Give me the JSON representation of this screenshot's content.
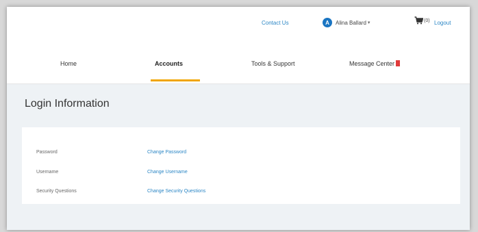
{
  "utility_bar": {
    "contact_us": "Contact Us",
    "user_initial": "A",
    "user_name": "Alina Ballard",
    "user_chevron": "▾",
    "cart_count": "(0)",
    "logout": "Logout"
  },
  "nav": {
    "tabs": [
      {
        "label": "Home"
      },
      {
        "label": "Accounts",
        "active": true
      },
      {
        "label": "Tools & Support"
      },
      {
        "label": "Message Center"
      }
    ],
    "active_accent": "#f0a500",
    "badge_color": "#e03a3a"
  },
  "main": {
    "title": "Login Information",
    "rows": [
      {
        "label": "Password",
        "link": "Change Password"
      },
      {
        "label": "Username",
        "link": "Change Username"
      },
      {
        "label": "Security Questions",
        "link": "Change Security Questions"
      }
    ]
  },
  "colors": {
    "link": "#2b86c5",
    "content_bg": "#eef2f5"
  },
  "icons": {
    "user": "user-avatar-icon",
    "cart": "cart-icon",
    "message_badge": "message-badge-icon"
  }
}
